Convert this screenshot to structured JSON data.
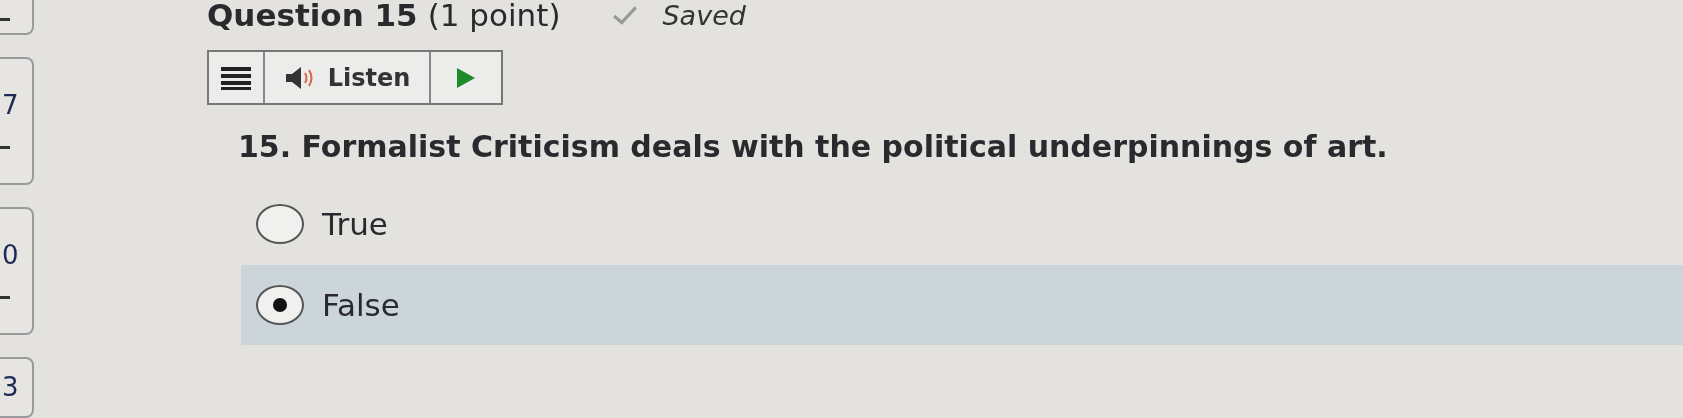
{
  "question_nav": [
    {
      "dash": true
    },
    {
      "number": "7",
      "dash": true
    },
    {
      "number": "0",
      "dash": true
    },
    {
      "number": "3",
      "dash": false
    }
  ],
  "header": {
    "title": "Question 15",
    "points": "(1 point)",
    "status": "Saved",
    "saved": true
  },
  "toolbar": {
    "listen_label": "Listen"
  },
  "question": {
    "text": "15. Formalist Criticism deals with the political underpinnings of art.",
    "options": [
      {
        "label": "True",
        "selected": false
      },
      {
        "label": "False",
        "selected": true
      }
    ]
  }
}
